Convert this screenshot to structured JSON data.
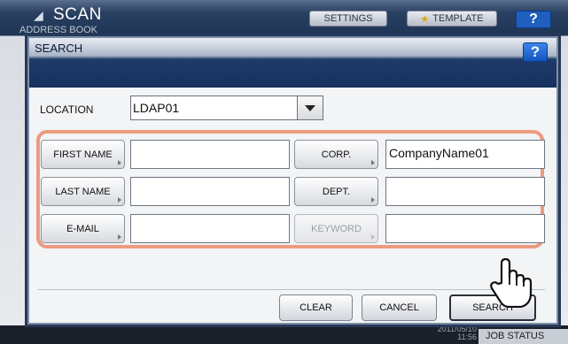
{
  "app": {
    "title": "SCAN",
    "subtitle": "ADDRESS BOOK",
    "settings_label": "SETTINGS",
    "template_label": "TEMPLATE",
    "help_label": "?",
    "time": "2011/05/10 11:56",
    "jobs_label": "JOB STATUS"
  },
  "dialog": {
    "title": "SEARCH",
    "help_label": "?",
    "location": {
      "label": "LOCATION",
      "value": "LDAP01"
    },
    "fields": [
      {
        "label": "FIRST NAME",
        "value": "",
        "disabled": false
      },
      {
        "label": "LAST NAME",
        "value": "",
        "disabled": false
      },
      {
        "label": "E-MAIL",
        "value": "",
        "disabled": false
      },
      {
        "label": "CORP.",
        "value": "CompanyName01",
        "disabled": false
      },
      {
        "label": "DEPT.",
        "value": "",
        "disabled": false
      },
      {
        "label": "KEYWORD",
        "value": "",
        "disabled": true
      }
    ],
    "buttons": {
      "clear": "CLEAR",
      "cancel": "CANCEL",
      "search": "SEARCH"
    }
  },
  "colors": {
    "header_dark": "#173260",
    "highlight_border": "#ec9b80",
    "help_blue": "#1e5fc0"
  },
  "icons": [
    "chevron-down-icon",
    "star-icon",
    "hand-pointer-icon",
    "help-icon"
  ]
}
